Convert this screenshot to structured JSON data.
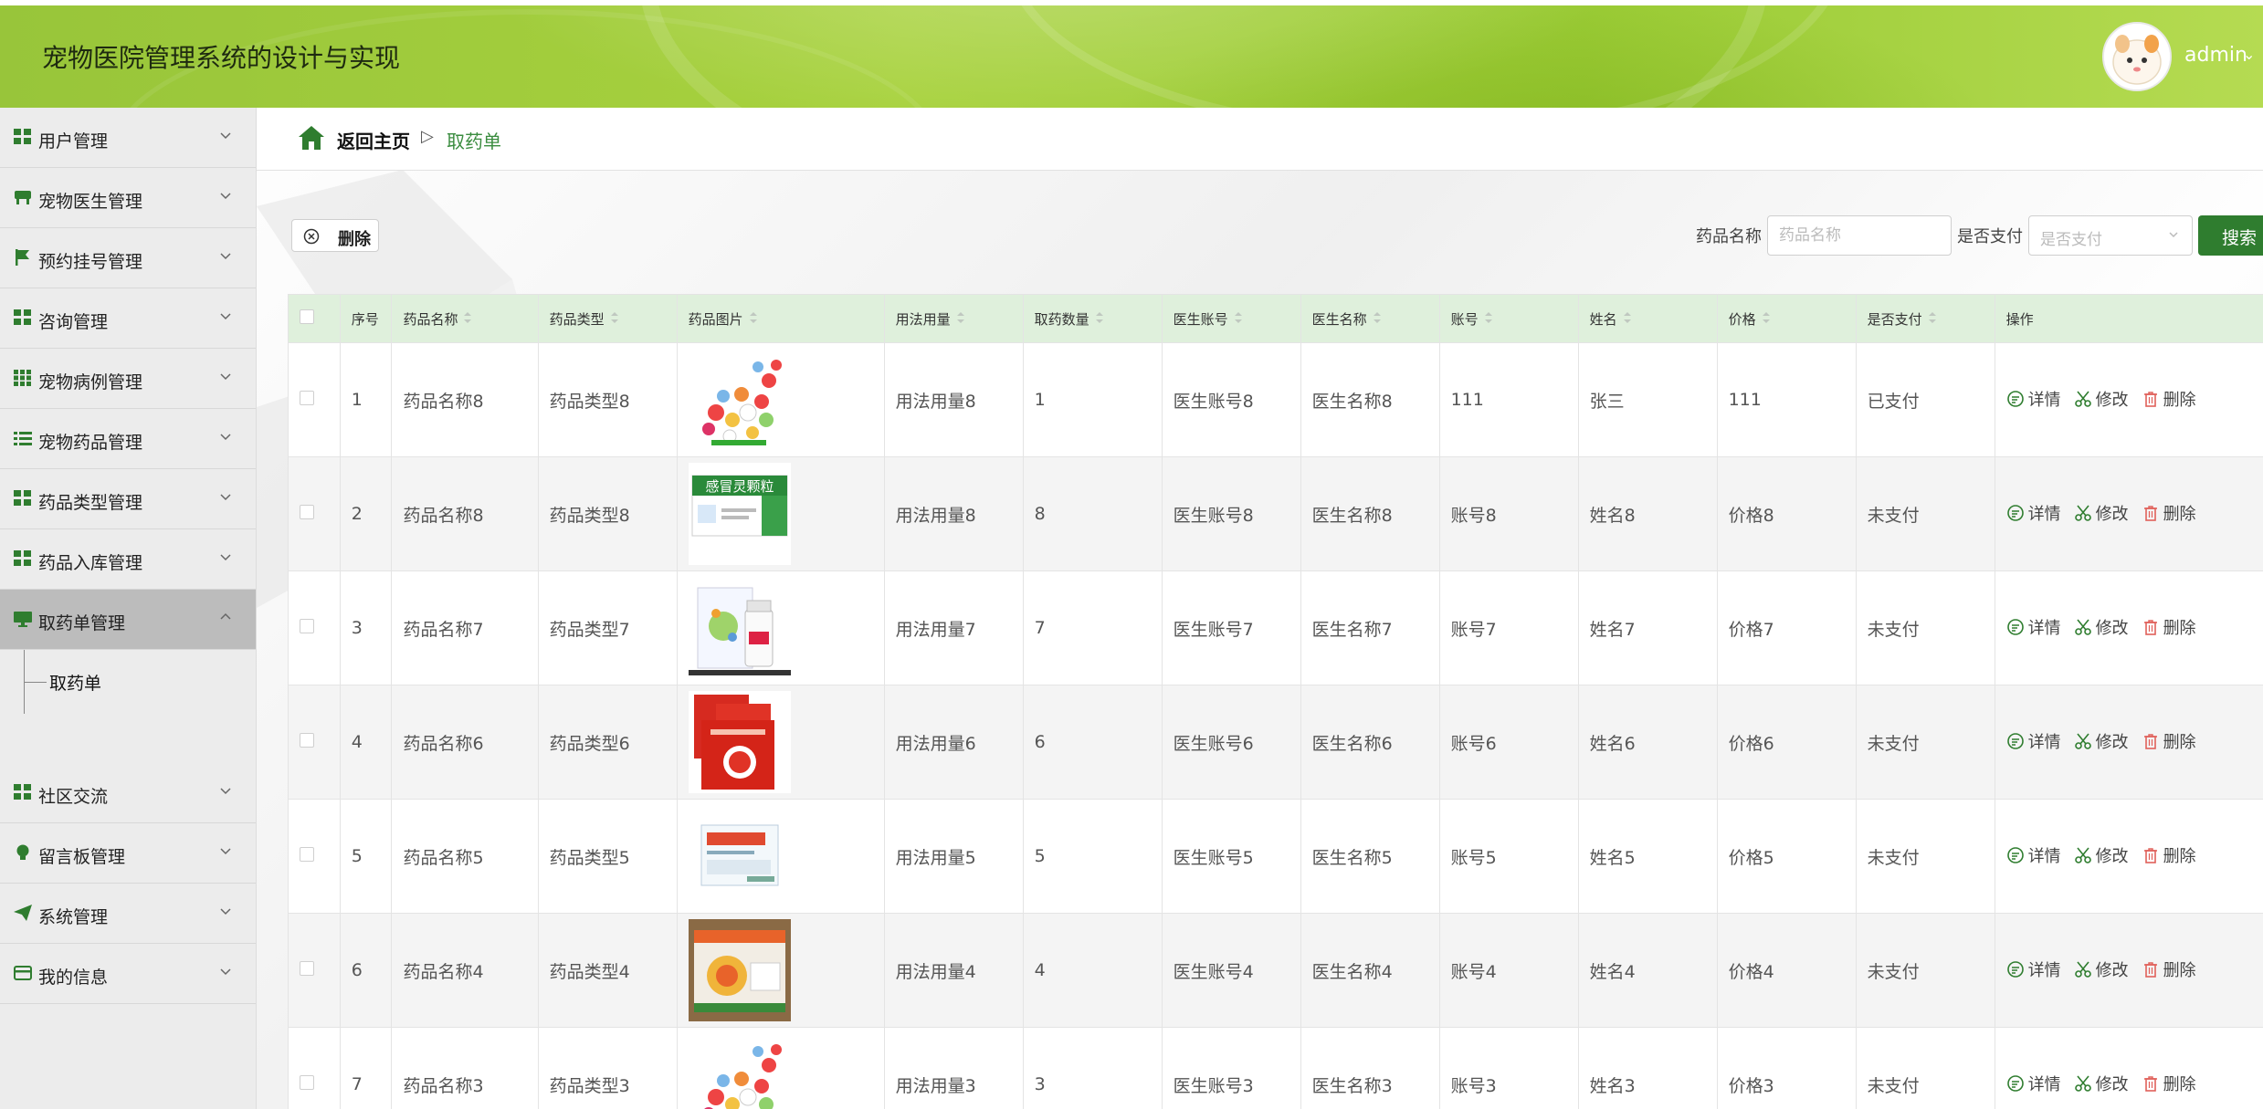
{
  "header": {
    "title": "宠物医院管理系统的设计与实现",
    "username": "admin"
  },
  "sidebar": {
    "items": [
      {
        "label": "用户管理",
        "icon": "grid-icon"
      },
      {
        "label": "宠物医生管理",
        "icon": "desk-icon"
      },
      {
        "label": "预约挂号管理",
        "icon": "flag-icon"
      },
      {
        "label": "咨询管理",
        "icon": "grid-icon"
      },
      {
        "label": "宠物病例管理",
        "icon": "apps-icon"
      },
      {
        "label": "宠物药品管理",
        "icon": "list-icon"
      },
      {
        "label": "药品类型管理",
        "icon": "grid-icon"
      },
      {
        "label": "药品入库管理",
        "icon": "grid-icon"
      },
      {
        "label": "取药单管理",
        "icon": "monitor-icon"
      },
      {
        "label": "社区交流",
        "icon": "grid-icon"
      },
      {
        "label": "留言板管理",
        "icon": "bulb-icon"
      },
      {
        "label": "系统管理",
        "icon": "send-icon"
      },
      {
        "label": "我的信息",
        "icon": "card-icon"
      }
    ],
    "sub_item": "取药单"
  },
  "breadcrumb": {
    "home": "返回主页",
    "separator": "▷",
    "current": "取药单"
  },
  "toolbar": {
    "delete_label": "删除",
    "search_name_label": "药品名称",
    "search_name_placeholder": "药品名称",
    "search_pay_label": "是否支付",
    "search_pay_placeholder": "是否支付",
    "search_button": "搜索"
  },
  "table": {
    "headers": [
      "序号",
      "药品名称",
      "药品类型",
      "药品图片",
      "用法用量",
      "取药数量",
      "医生账号",
      "医生名称",
      "账号",
      "姓名",
      "价格",
      "是否支付",
      "操作"
    ],
    "actions": {
      "detail": "详情",
      "edit": "修改",
      "delete": "删除"
    },
    "rows": [
      {
        "no": "1",
        "name": "药品名称8",
        "type": "药品类型8",
        "image": "pills-image",
        "usage": "用法用量8",
        "qty": "1",
        "doc_account": "医生账号8",
        "doc_name": "医生名称8",
        "account": "111",
        "person": "张三",
        "price": "111",
        "paid": "已支付"
      },
      {
        "no": "2",
        "name": "药品名称8",
        "type": "药品类型8",
        "image": "granules-box-image",
        "usage": "用法用量8",
        "qty": "8",
        "doc_account": "医生账号8",
        "doc_name": "医生名称8",
        "account": "账号8",
        "person": "姓名8",
        "price": "价格8",
        "paid": "未支付"
      },
      {
        "no": "3",
        "name": "药品名称7",
        "type": "药品类型7",
        "image": "bottle-box-image",
        "usage": "用法用量7",
        "qty": "7",
        "doc_account": "医生账号7",
        "doc_name": "医生名称7",
        "account": "账号7",
        "person": "姓名7",
        "price": "价格7",
        "paid": "未支付"
      },
      {
        "no": "4",
        "name": "药品名称6",
        "type": "药品类型6",
        "image": "red-packets-image",
        "usage": "用法用量6",
        "qty": "6",
        "doc_account": "医生账号6",
        "doc_name": "医生名称6",
        "account": "账号6",
        "person": "姓名6",
        "price": "价格6",
        "paid": "未支付"
      },
      {
        "no": "5",
        "name": "药品名称5",
        "type": "药品类型5",
        "image": "tablet-box-image",
        "usage": "用法用量5",
        "qty": "5",
        "doc_account": "医生账号5",
        "doc_name": "医生名称5",
        "account": "账号5",
        "person": "姓名5",
        "price": "价格5",
        "paid": "未支付"
      },
      {
        "no": "6",
        "name": "药品名称4",
        "type": "药品类型4",
        "image": "orange-box-image",
        "usage": "用法用量4",
        "qty": "4",
        "doc_account": "医生账号4",
        "doc_name": "医生名称4",
        "account": "账号4",
        "person": "姓名4",
        "price": "价格4",
        "paid": "未支付"
      },
      {
        "no": "7",
        "name": "药品名称3",
        "type": "药品类型3",
        "image": "pills-image",
        "usage": "用法用量3",
        "qty": "3",
        "doc_account": "医生账号3",
        "doc_name": "医生名称3",
        "account": "账号3",
        "person": "姓名3",
        "price": "价格3",
        "paid": "未支付"
      }
    ]
  },
  "colors": {
    "accent": "#2f7d2f",
    "header_bg": "#a3cf3c",
    "table_header_bg": "#dff0dc",
    "breadcrumb_current": "#3a8c3f"
  }
}
